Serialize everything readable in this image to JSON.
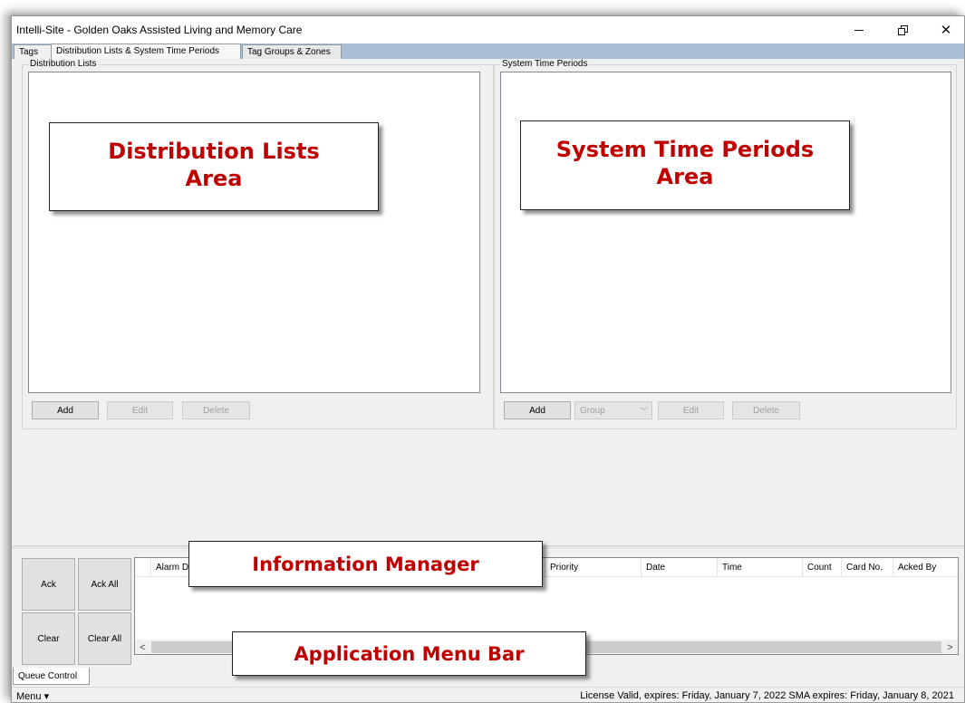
{
  "window": {
    "title": "Intelli-Site - Golden Oaks Assisted Living and Memory Care",
    "controls": {
      "minimize": "minimize-icon",
      "restore": "restore-icon",
      "close": "✕"
    }
  },
  "tabs": [
    {
      "label": "Tags"
    },
    {
      "label": "Distribution Lists & System Time Periods",
      "active": true
    },
    {
      "label": "Tag Groups & Zones"
    }
  ],
  "distribution_lists": {
    "title": "Distribution Lists",
    "callout_line1": "Distribution Lists",
    "callout_line2": "Area",
    "buttons": {
      "add": "Add",
      "edit": "Edit",
      "delete": "Delete"
    }
  },
  "system_time_periods": {
    "title": "System Time Periods",
    "callout_line1": "System Time Periods",
    "callout_line2": "Area",
    "buttons": {
      "add": "Add",
      "group": "Group",
      "edit": "Edit",
      "delete": "Delete"
    },
    "group_chevron": "﹀"
  },
  "queue": {
    "buttons": {
      "ack": "Ack",
      "ack_all": "Ack All",
      "clear": "Clear",
      "clear_all": "Clear All"
    },
    "columns": [
      "Alarm De",
      "Priority",
      "Date",
      "Time",
      "Count",
      "Card No.",
      "Acked By"
    ],
    "scroll_left": "<",
    "scroll_right": ">",
    "callout": "Information Manager"
  },
  "bottom": {
    "tab_label": "Queue Control",
    "menu_label": "Menu ▾",
    "menu_callout": "Application Menu Bar",
    "license_text": "License Valid, expires: Friday, January 7, 2022 SMA expires: Friday, January 8, 2021"
  },
  "colors": {
    "tabstrip": "#a9bfd6",
    "callout_text": "#c00000",
    "panel_bg": "#f0f0f0"
  }
}
